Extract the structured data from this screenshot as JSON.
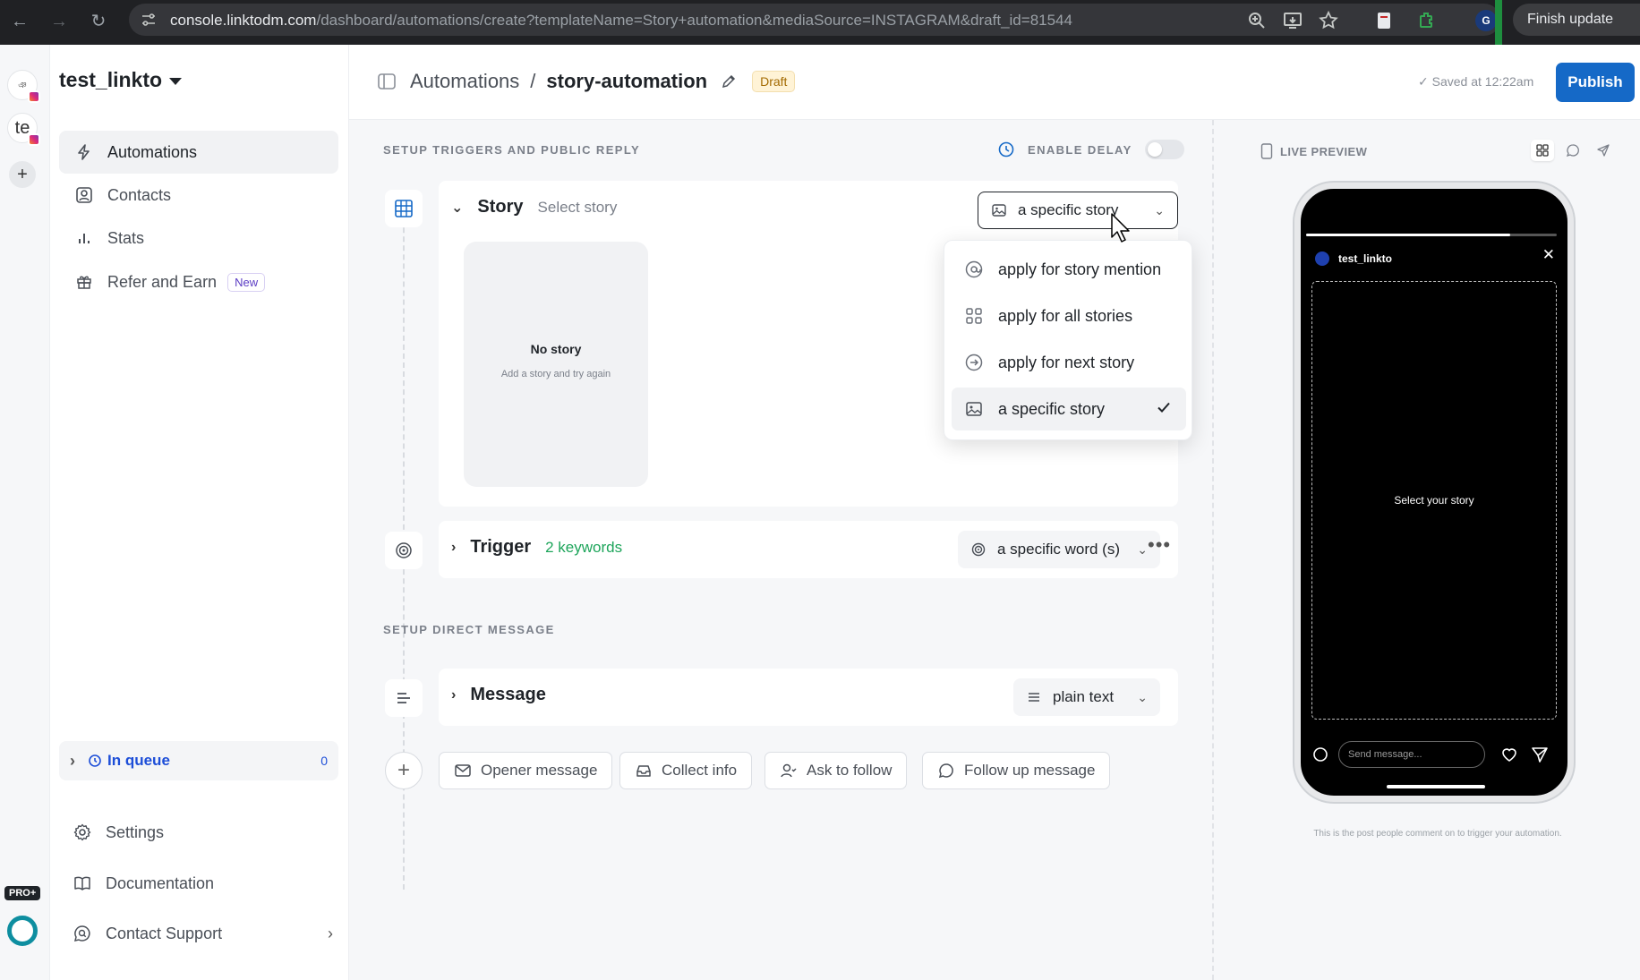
{
  "browser": {
    "url_domain": "console.linktodm.com",
    "url_path": "/dashboard/automations/create?templateName=Story+automation&mediaSource=INSTAGRAM&draft_id=81544",
    "finish_update": "Finish update",
    "profile_initial": "G"
  },
  "rail": {
    "accounts": [
      "",
      "te"
    ],
    "plus": "+",
    "pro_badge": "PRO+"
  },
  "sidebar": {
    "workspace": "test_linkto",
    "items": [
      {
        "label": "Automations",
        "icon": "bolt-icon"
      },
      {
        "label": "Contacts",
        "icon": "contacts-icon"
      },
      {
        "label": "Stats",
        "icon": "stats-icon"
      },
      {
        "label": "Refer and Earn",
        "icon": "gift-icon",
        "badge": "New"
      }
    ],
    "queue": {
      "label": "In queue",
      "count": "0"
    },
    "bottom": [
      {
        "label": "Settings",
        "icon": "gear-icon"
      },
      {
        "label": "Documentation",
        "icon": "book-icon"
      },
      {
        "label": "Contact Support",
        "icon": "support-icon"
      }
    ]
  },
  "topbar": {
    "root": "Automations",
    "separator": "/",
    "current": "story-automation",
    "status": "Draft",
    "saved": "Saved at 12:22am",
    "publish": "Publish"
  },
  "editor": {
    "section_triggers": "SETUP TRIGGERS AND PUBLIC REPLY",
    "enable_delay": "ENABLE DELAY",
    "story": {
      "title": "Story",
      "subtitle": "Select story",
      "select_value": "a specific story",
      "empty_title": "No story",
      "empty_sub": "Add a story and try again"
    },
    "trigger": {
      "title": "Trigger",
      "subtitle": "2 keywords",
      "select_value": "a specific word (s)"
    },
    "section_dm": "SETUP DIRECT MESSAGE",
    "more": "•••",
    "message": {
      "title": "Message",
      "select_value": "plain text"
    },
    "chips": [
      "Opener message",
      "Collect info",
      "Ask to follow",
      "Follow up message"
    ]
  },
  "dropdown": {
    "options": [
      {
        "label": "apply for story mention",
        "icon": "at-icon"
      },
      {
        "label": "apply for all stories",
        "icon": "grid-icon"
      },
      {
        "label": "apply for next story",
        "icon": "arrow-circle-icon"
      },
      {
        "label": "a specific story",
        "icon": "image-icon",
        "selected": true
      }
    ]
  },
  "preview": {
    "label": "LIVE PREVIEW",
    "username": "test_linkto",
    "placeholder": "Select your story",
    "send_placeholder": "Send message...",
    "caption": "This is the post people comment on to trigger your automation."
  },
  "colors": {
    "publish": "#1569c7",
    "accent_blue": "#1d4ed8",
    "keywords_green": "#1ea55b",
    "draft_bg": "#fff3d6"
  }
}
